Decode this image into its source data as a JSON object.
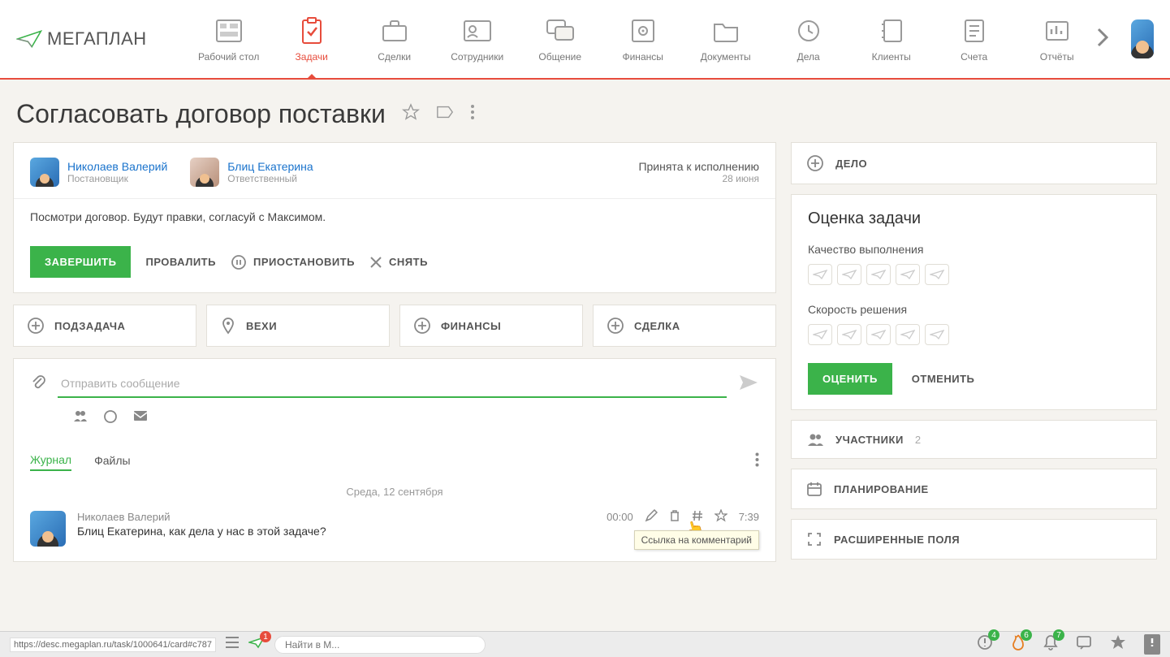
{
  "logo": "МЕГАПЛАН",
  "nav": [
    {
      "label": "Рабочий стол"
    },
    {
      "label": "Задачи"
    },
    {
      "label": "Сделки"
    },
    {
      "label": "Сотрудники"
    },
    {
      "label": "Общение"
    },
    {
      "label": "Финансы"
    },
    {
      "label": "Документы"
    },
    {
      "label": "Дела"
    },
    {
      "label": "Клиенты"
    },
    {
      "label": "Счета"
    },
    {
      "label": "Отчёты"
    }
  ],
  "page_title": "Согласовать договор поставки",
  "owner": {
    "name": "Николаев Валерий",
    "role": "Постановщик"
  },
  "responsible": {
    "name": "Блиц Екатерина",
    "role": "Ответственный"
  },
  "status": {
    "label": "Принята к исполнению",
    "date": "28 июня"
  },
  "description": "Посмотри договор. Будут правки, согласуй с Максимом.",
  "actions": {
    "complete": "ЗАВЕРШИТЬ",
    "fail": "ПРОВАЛИТЬ",
    "pause": "ПРИОСТАНОВИТЬ",
    "remove": "СНЯТЬ"
  },
  "quick": {
    "subtask": "ПОДЗАДАЧА",
    "milestone": "ВЕХИ",
    "finance": "ФИНАНСЫ",
    "deal": "СДЕЛКА"
  },
  "message": {
    "placeholder": "Отправить сообщение"
  },
  "tabs": {
    "journal": "Журнал",
    "files": "Файлы"
  },
  "date_sep": "Среда, 12 сентября",
  "comment": {
    "author": "Николаев Валерий",
    "text": "Блиц Екатерина, как дела у нас в этой задаче?",
    "audio": "00:00",
    "time": "7:39"
  },
  "tooltip": "Ссылка на комментарий",
  "right": {
    "delo": "ДЕЛО",
    "rating_title": "Оценка задачи",
    "quality": "Качество выполнения",
    "speed": "Скорость решения",
    "rate": "ОЦЕНИТЬ",
    "cancel": "ОТМЕНИТЬ",
    "participants": "УЧАСТНИКИ",
    "participants_count": "2",
    "planning": "ПЛАНИРОВАНИЕ",
    "extended": "РАСШИРЕННЫЕ ПОЛЯ"
  },
  "bottom": {
    "url": "https://desc.megaplan.ru/task/1000641/card#c787",
    "logo_badge": "1",
    "search": "Найти в М...",
    "b1": "4",
    "b2": "6",
    "b3": "7"
  }
}
